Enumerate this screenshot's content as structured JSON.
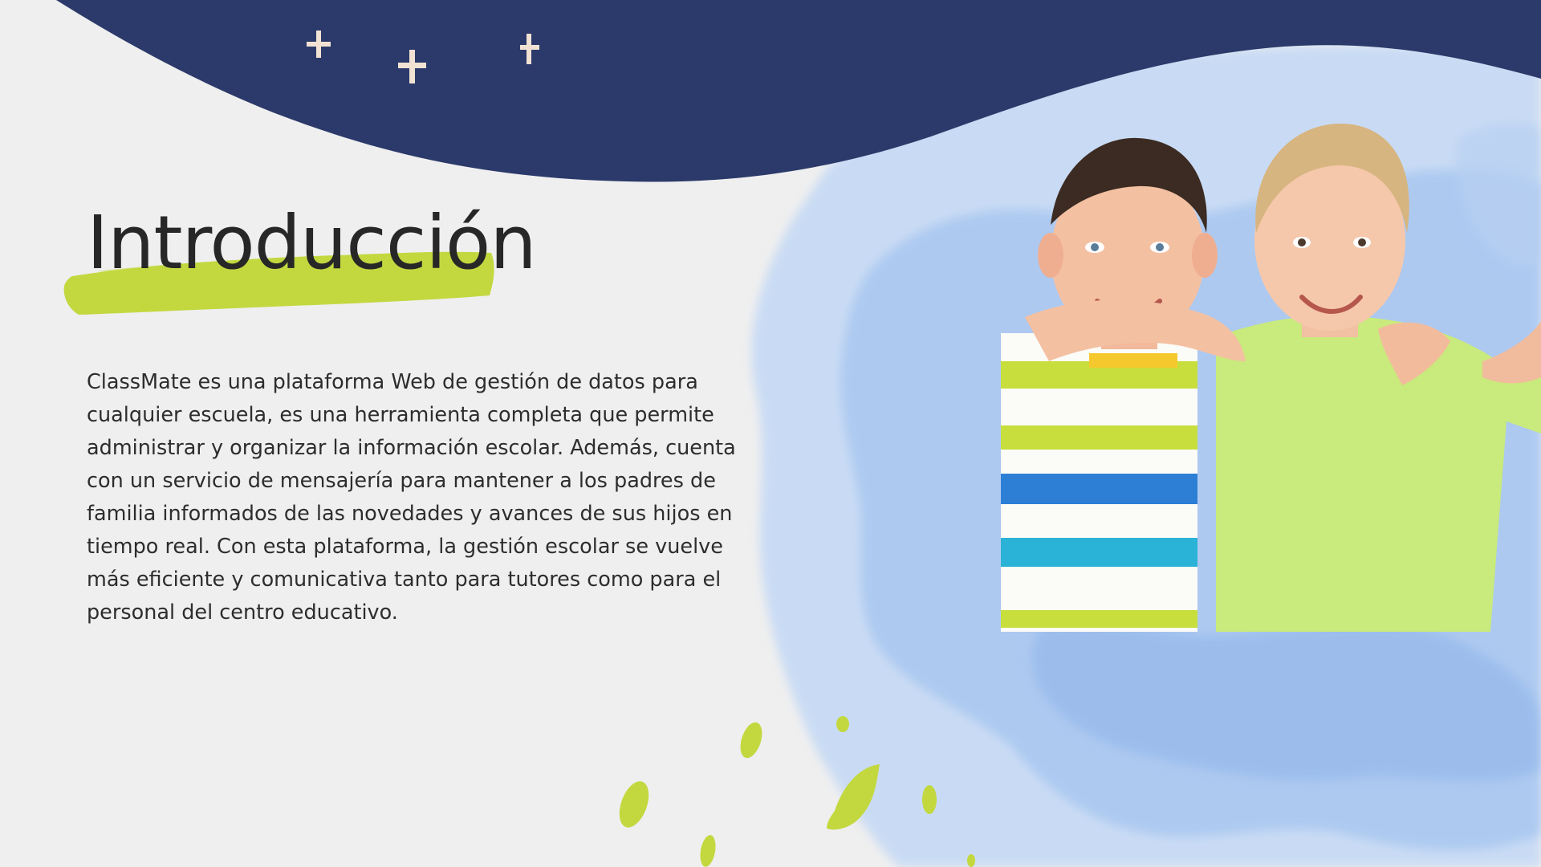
{
  "slide": {
    "title": "Introducción",
    "body": "ClassMate es una plataforma Web de gestión de datos para cualquier escuela, es una herramienta completa que permite administrar y organizar la información escolar. Además, cuenta con un servicio de mensajería para mantener a los padres de familia informados de las novedades y avances de sus hijos en tiempo real. Con esta plataforma, la gestión escolar se vuelve más eficiente y comunicativa tanto para tutores como para el personal del centro educativo."
  },
  "decor": {
    "icons": [
      "sparkle-icon",
      "sparkle-icon",
      "sparkle-icon",
      "leaf-icon"
    ],
    "image": "photo of two smiling boys hugging"
  },
  "colors": {
    "background": "#efefef",
    "navy_wave": "#2b3a6a",
    "watercolor_blue": "#9dbfee",
    "lime_accent": "#c3d83f",
    "sparkle": "#f1e2d3",
    "text": "#272727"
  }
}
